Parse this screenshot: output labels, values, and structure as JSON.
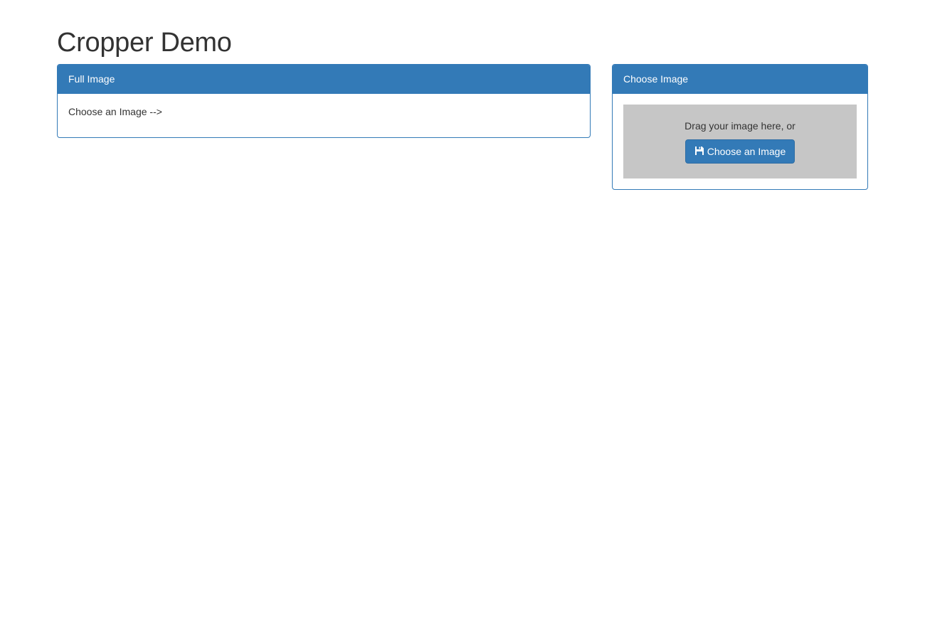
{
  "page": {
    "title": "Cropper Demo"
  },
  "full_image_panel": {
    "heading": "Full Image",
    "body_text": "Choose an Image -->"
  },
  "choose_image_panel": {
    "heading": "Choose Image",
    "dropzone_text": "Drag your image here, or",
    "button_label": "Choose an Image",
    "button_icon": "floppy-disk-icon"
  },
  "colors": {
    "primary": "#337ab7",
    "dropzone_bg": "#c6c6c6",
    "text": "#333333"
  }
}
